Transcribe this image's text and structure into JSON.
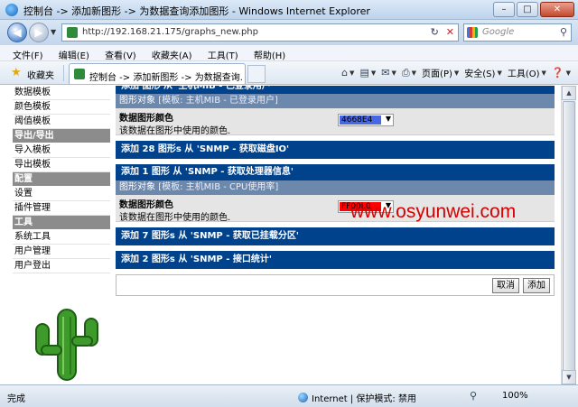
{
  "window": {
    "title": "控制台 -> 添加新图形 -> 为数据查询添加图形 - Windows Internet Explorer"
  },
  "address": {
    "url": "http://192.168.21.175/graphs_new.php",
    "search_placeholder": "Google"
  },
  "menu": [
    "文件(F)",
    "编辑(E)",
    "查看(V)",
    "收藏夹(A)",
    "工具(T)",
    "帮助(H)"
  ],
  "favorites": {
    "label": "收藏夹",
    "tab_title": "控制台 -> 添加新图形 -> 为数据查询..."
  },
  "commands": {
    "page": "页面(P)",
    "safety": "安全(S)",
    "tools": "工具(O)"
  },
  "sidebar": {
    "items": [
      {
        "label": "数据模板",
        "type": "item"
      },
      {
        "label": "颜色模板",
        "type": "item"
      },
      {
        "label": "阈值模板",
        "type": "item"
      },
      {
        "label": "导出/导出",
        "type": "category"
      },
      {
        "label": "导入模板",
        "type": "item"
      },
      {
        "label": "导出模板",
        "type": "item"
      },
      {
        "label": "配置",
        "type": "category"
      },
      {
        "label": "设置",
        "type": "item"
      },
      {
        "label": "插件管理",
        "type": "item"
      },
      {
        "label": "工具",
        "type": "category"
      },
      {
        "label": "系统工具",
        "type": "item"
      },
      {
        "label": "用户管理",
        "type": "item"
      },
      {
        "label": "用户登出",
        "type": "item"
      }
    ]
  },
  "main": {
    "header_partial": "添加 图形 从 '主机MIB - 已登录用户'",
    "section1": {
      "object_label": "图形对象",
      "template_hint": "[模板: 主机MIB - 已登录用户]",
      "field_name": "数据图形颜色",
      "field_desc": "该数据在图形中使用的颜色.",
      "color_value": "4668E4",
      "color_hex": "#4668E4"
    },
    "header2": "添加 28 图形s 从 'SNMP - 获取磁盘IO'",
    "header3": "添加 1 图形 从 'SNMP - 获取处理器信息'",
    "section2": {
      "object_label": "图形对象",
      "template_hint": "[模板: 主机MIB - CPU使用率]",
      "field_name": "数据图形颜色",
      "field_desc": "该数据在图形中使用的颜色.",
      "color_value": "FF00L0",
      "color_hex": "#FF0000"
    },
    "header4": "添加 7 图形s 从 'SNMP - 获取已挂载分区'",
    "header5": "添加 2 图形s 从 'SNMP - 接口统计'",
    "cancel_label": "取消",
    "add_label": "添加"
  },
  "watermark": "www.osyunwei.com",
  "status": {
    "left": "完成",
    "zone": "Internet | 保护模式: 禁用",
    "zoom": "100%"
  }
}
